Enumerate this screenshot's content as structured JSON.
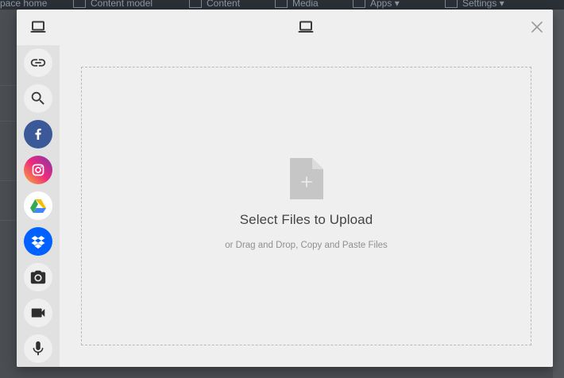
{
  "background_app": {
    "nav_items": [
      {
        "label": "pace home"
      },
      {
        "label": "Content model"
      },
      {
        "label": "Content"
      },
      {
        "label": "Media"
      },
      {
        "label": "Apps"
      },
      {
        "label": "Settings"
      }
    ]
  },
  "modal": {
    "header": {
      "left_icon": "laptop-icon",
      "center_icon": "laptop-icon",
      "close_icon": "close-icon"
    },
    "sources": [
      {
        "name": "link",
        "icon": "link-icon",
        "bg": "#efefef"
      },
      {
        "name": "search",
        "icon": "search-icon",
        "bg": "#efefef"
      },
      {
        "name": "facebook",
        "icon": "facebook-icon",
        "bg": "#3b5998"
      },
      {
        "name": "instagram",
        "icon": "instagram-icon",
        "bg": "#e1306c"
      },
      {
        "name": "google-drive",
        "icon": "google-drive-icon",
        "bg": "#ffffff"
      },
      {
        "name": "dropbox",
        "icon": "dropbox-icon",
        "bg": "#0061fe"
      },
      {
        "name": "camera",
        "icon": "camera-icon",
        "bg": "#efefef"
      },
      {
        "name": "video",
        "icon": "video-camera-icon",
        "bg": "#efefef"
      },
      {
        "name": "audio",
        "icon": "microphone-icon",
        "bg": "#efefef"
      }
    ],
    "dropzone": {
      "title": "Select Files to Upload",
      "subtitle": "or Drag and Drop, Copy and Paste Files",
      "file_icon": "file-add-icon"
    }
  },
  "colors": {
    "modal_bg": "#efefef",
    "sidebar_bg": "#e1e1e1",
    "icon_gray": "#c6c6c6",
    "title_text": "#444444",
    "subtitle_text": "#8f8f8f"
  }
}
